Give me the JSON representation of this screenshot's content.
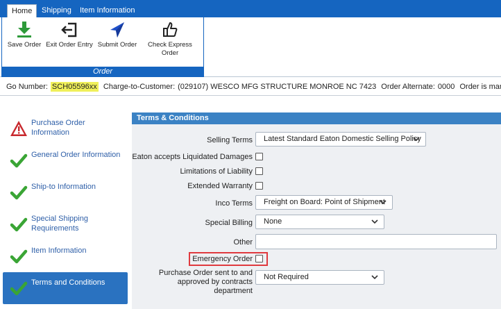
{
  "ribbon": {
    "tabs": [
      {
        "label": "Home",
        "active": true
      },
      {
        "label": "Shipping",
        "active": false
      },
      {
        "label": "Item Information",
        "active": false
      }
    ],
    "group_label": "Order",
    "buttons": {
      "save": "Save Order",
      "exit": "Exit Order Entry",
      "submit": "Submit Order",
      "check_express": "Check Express Order"
    }
  },
  "info": {
    "go_number_label": "Go Number:",
    "go_number_value": "SCH05596xx",
    "charge_label": "Charge-to-Customer:",
    "charge_value": "(029107) WESCO MFG STRUCTURE MONROE NC 7423",
    "alternate_label": "Order Alternate:",
    "alternate_value": "0000",
    "managed_text": "Order is managed by"
  },
  "nav": {
    "items": [
      {
        "label": "Purchase Order Information",
        "status": "warning-icon"
      },
      {
        "label": "General Order Information",
        "status": "check-icon"
      },
      {
        "label": "Ship-to Information",
        "status": "check-icon"
      },
      {
        "label": "Special Shipping Requirements",
        "status": "check-icon"
      },
      {
        "label": "Item Information",
        "status": "check-icon"
      },
      {
        "label": "Terms and Conditions",
        "status": "check-icon",
        "active": true
      }
    ]
  },
  "panel": {
    "title": "Terms & Conditions",
    "selling_terms_label": "Selling Terms",
    "selling_terms_value": "Latest Standard Eaton Domestic Selling Policy",
    "liquidated_label": "Eaton accepts Liquidated Damages",
    "liability_label": "Limitations of Liability",
    "warranty_label": "Extended Warranty",
    "inco_label": "Inco Terms",
    "inco_value": "Freight on Board: Point of Shipment",
    "billing_label": "Special Billing",
    "billing_value": "None",
    "other_label": "Other",
    "other_value": "",
    "emergency_label": "Emergency Order",
    "po_sent_label": "Purchase Order sent to and approved by contracts department",
    "po_sent_value": "Not Required"
  },
  "colors": {
    "ribbon_blue": "#1565c0",
    "panel_header": "#3b82c4",
    "nav_active": "#2a72c0",
    "check_green": "#3aa535",
    "warning_red": "#c8282d",
    "highlight_yellow": "#f0f05a",
    "callout_red": "#e0393e"
  }
}
